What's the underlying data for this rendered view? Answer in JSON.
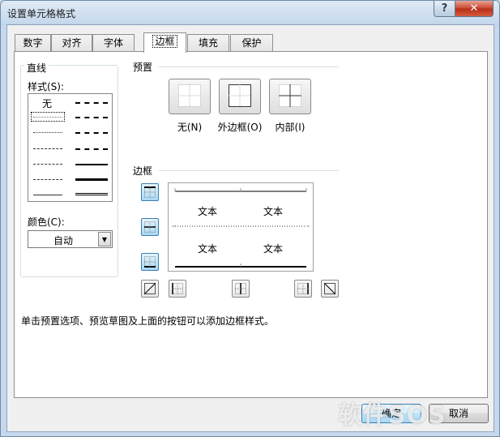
{
  "window": {
    "title": "设置单元格格式"
  },
  "tabs": [
    "数字",
    "对齐",
    "字体",
    "边框",
    "填充",
    "保护"
  ],
  "active_tab": "边框",
  "line": {
    "group_label": "直线",
    "style_label": "样式(S):",
    "none_label": "无",
    "color_label": "颜色(C):",
    "color_value": "自动"
  },
  "presets": {
    "group_label": "预置",
    "items": [
      "无(N)",
      "外边框(O)",
      "内部(I)"
    ]
  },
  "border": {
    "group_label": "边框",
    "preview_text": [
      "文本",
      "文本",
      "文本",
      "文本"
    ]
  },
  "hint": "单击预置选项、预览草图及上面的按钮可以添加边框样式。",
  "buttons": {
    "ok": "确定",
    "cancel": "取消"
  },
  "watermark": "软件SOS",
  "colors": {
    "accent": "#3c7fb1",
    "close": "#c7462d"
  }
}
